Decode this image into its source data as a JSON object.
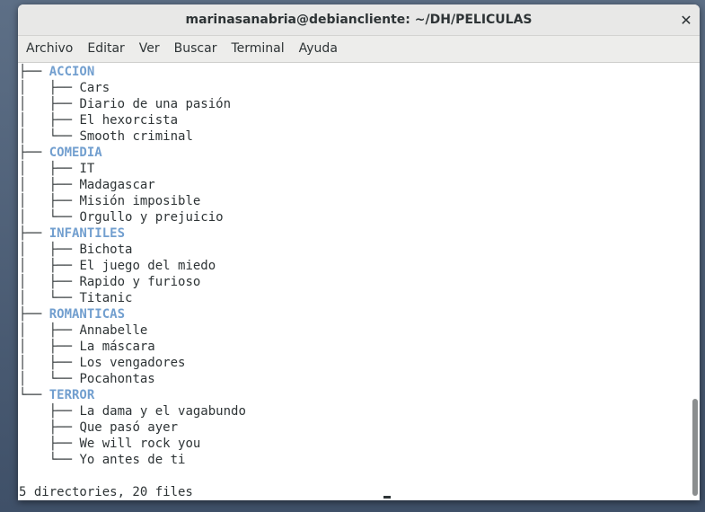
{
  "window": {
    "title": "marinasanabria@debiancliente: ~/DH/PELICULAS",
    "close_icon": "close-icon"
  },
  "menu": [
    {
      "label": "Archivo"
    },
    {
      "label": "Editar"
    },
    {
      "label": "Ver"
    },
    {
      "label": "Buscar"
    },
    {
      "label": "Terminal"
    },
    {
      "label": "Ayuda"
    }
  ],
  "terminal": {
    "colors": {
      "directory": "#729fcf",
      "text": "#2e3436"
    },
    "tree": [
      {
        "prefix": "├── ",
        "name": "ACCION",
        "is_dir": true
      },
      {
        "prefix": "│   ├── ",
        "name": "Cars",
        "is_dir": false
      },
      {
        "prefix": "│   ├── ",
        "name": "Diario de una pasión",
        "is_dir": false
      },
      {
        "prefix": "│   ├── ",
        "name": "El hexorcista",
        "is_dir": false
      },
      {
        "prefix": "│   └── ",
        "name": "Smooth criminal",
        "is_dir": false
      },
      {
        "prefix": "├── ",
        "name": "COMEDIA",
        "is_dir": true
      },
      {
        "prefix": "│   ├── ",
        "name": "IT",
        "is_dir": false
      },
      {
        "prefix": "│   ├── ",
        "name": "Madagascar",
        "is_dir": false
      },
      {
        "prefix": "│   ├── ",
        "name": "Misión imposible",
        "is_dir": false
      },
      {
        "prefix": "│   └── ",
        "name": "Orgullo y prejuicio",
        "is_dir": false
      },
      {
        "prefix": "├── ",
        "name": "INFANTILES",
        "is_dir": true
      },
      {
        "prefix": "│   ├── ",
        "name": "Bichota",
        "is_dir": false
      },
      {
        "prefix": "│   ├── ",
        "name": "El juego del miedo",
        "is_dir": false
      },
      {
        "prefix": "│   ├── ",
        "name": "Rapido y furioso",
        "is_dir": false
      },
      {
        "prefix": "│   └── ",
        "name": "Titanic",
        "is_dir": false
      },
      {
        "prefix": "├── ",
        "name": "ROMANTICAS",
        "is_dir": true
      },
      {
        "prefix": "│   ├── ",
        "name": "Annabelle",
        "is_dir": false
      },
      {
        "prefix": "│   ├── ",
        "name": "La máscara",
        "is_dir": false
      },
      {
        "prefix": "│   ├── ",
        "name": "Los vengadores",
        "is_dir": false
      },
      {
        "prefix": "│   └── ",
        "name": "Pocahontas",
        "is_dir": false
      },
      {
        "prefix": "└── ",
        "name": "TERROR",
        "is_dir": true
      },
      {
        "prefix": "    ├── ",
        "name": "La dama y el vagabundo",
        "is_dir": false
      },
      {
        "prefix": "    ├── ",
        "name": "Que pasó ayer",
        "is_dir": false
      },
      {
        "prefix": "    ├── ",
        "name": "We will rock you",
        "is_dir": false
      },
      {
        "prefix": "    └── ",
        "name": "Yo antes de ti",
        "is_dir": false
      }
    ],
    "summary": "5 directories, 20 files"
  }
}
